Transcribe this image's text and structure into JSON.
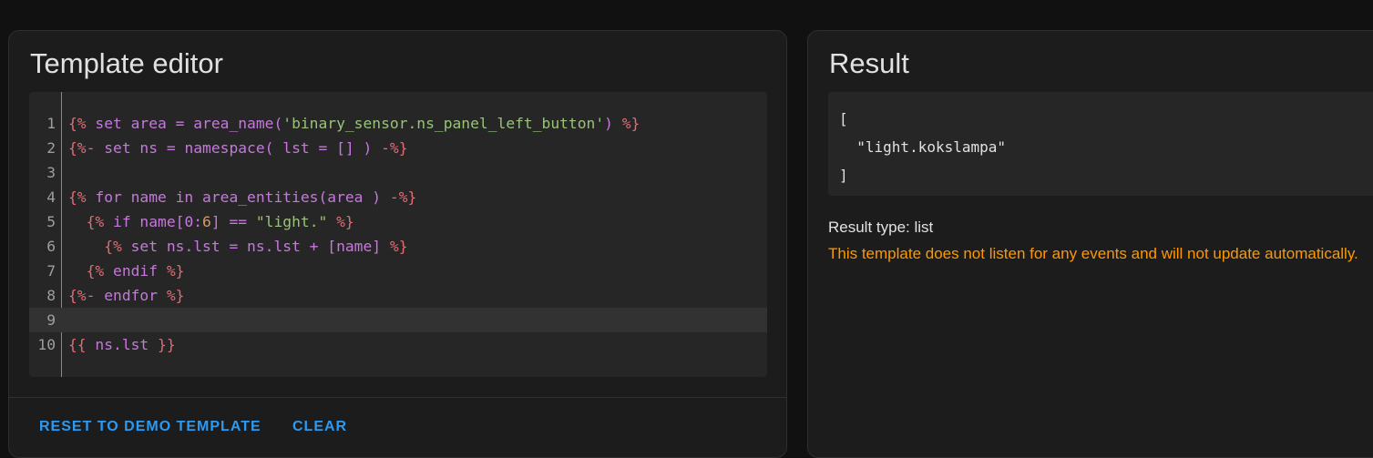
{
  "editor": {
    "title": "Template editor",
    "code_lines": [
      {
        "num": "1",
        "tokens": [
          {
            "t": "{%",
            "c": "t-tag"
          },
          {
            "t": " set area = area_name(",
            "c": "t-kw"
          },
          {
            "t": "'binary_sensor.ns_panel_left_button'",
            "c": "t-str"
          },
          {
            "t": ") ",
            "c": "t-kw"
          },
          {
            "t": "%}",
            "c": "t-tag"
          }
        ]
      },
      {
        "num": "2",
        "tokens": [
          {
            "t": "{%-",
            "c": "t-tag"
          },
          {
            "t": " set ns = namespace( lst = [] ) ",
            "c": "t-kw"
          },
          {
            "t": "-%}",
            "c": "t-tag"
          }
        ]
      },
      {
        "num": "3",
        "tokens": []
      },
      {
        "num": "4",
        "tokens": [
          {
            "t": "{%",
            "c": "t-tag"
          },
          {
            "t": " for name in area_entities(area ) ",
            "c": "t-kw"
          },
          {
            "t": "-%}",
            "c": "t-tag"
          }
        ]
      },
      {
        "num": "5",
        "tokens": [
          {
            "t": "  ",
            "c": "t-kw"
          },
          {
            "t": "{%",
            "c": "t-tag"
          },
          {
            "t": " if name[0:",
            "c": "t-kw"
          },
          {
            "t": "6",
            "c": "t-num"
          },
          {
            "t": "] == ",
            "c": "t-kw"
          },
          {
            "t": "\"light.\"",
            "c": "t-str"
          },
          {
            "t": " ",
            "c": "t-kw"
          },
          {
            "t": "%}",
            "c": "t-tag"
          }
        ]
      },
      {
        "num": "6",
        "tokens": [
          {
            "t": "    ",
            "c": "t-kw"
          },
          {
            "t": "{%",
            "c": "t-tag"
          },
          {
            "t": " set ns.lst = ns.lst + [name] ",
            "c": "t-kw"
          },
          {
            "t": "%}",
            "c": "t-tag"
          }
        ]
      },
      {
        "num": "7",
        "tokens": [
          {
            "t": "  ",
            "c": "t-kw"
          },
          {
            "t": "{%",
            "c": "t-tag"
          },
          {
            "t": " endif ",
            "c": "t-kw"
          },
          {
            "t": "%}",
            "c": "t-tag"
          }
        ]
      },
      {
        "num": "8",
        "tokens": [
          {
            "t": "{%-",
            "c": "t-tag"
          },
          {
            "t": " endfor ",
            "c": "t-kw"
          },
          {
            "t": "%}",
            "c": "t-tag"
          }
        ]
      },
      {
        "num": "9",
        "tokens": [],
        "active": true
      },
      {
        "num": "10",
        "tokens": [
          {
            "t": "{{",
            "c": "t-tag"
          },
          {
            "t": " ns.lst ",
            "c": "t-kw"
          },
          {
            "t": "}}",
            "c": "t-tag"
          }
        ]
      }
    ],
    "reset_label": "RESET TO DEMO TEMPLATE",
    "clear_label": "CLEAR"
  },
  "result": {
    "title": "Result",
    "output": "[\n  \"light.kokslampa\"\n]",
    "type_text": "Result type: list",
    "warning": "This template does not listen for any events and will not update automatically."
  },
  "colors": {
    "accent": "#2b9af3",
    "warning": "#ff9800",
    "card_bg": "#1c1c1c",
    "code_bg": "#262626",
    "template_tag": "#e06c75",
    "keyword": "#c678dd",
    "string": "#98c379",
    "number": "#d19a66"
  }
}
